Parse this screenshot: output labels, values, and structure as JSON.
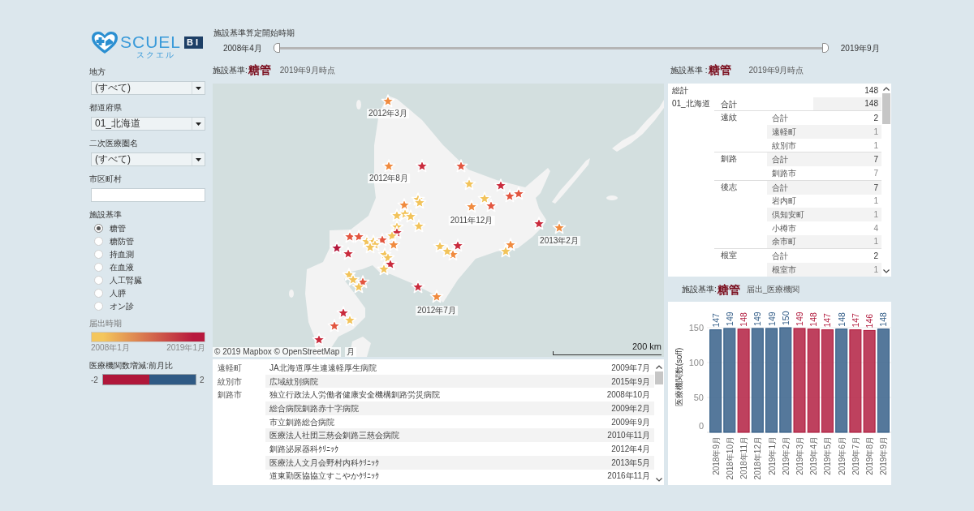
{
  "logo": {
    "name": "SCUEL",
    "kana": "スクエル",
    "badge": "BI"
  },
  "filters": [
    {
      "kind": "dropdown",
      "label": "地方",
      "value": "(すべて)"
    },
    {
      "kind": "dropdown",
      "label": "都道府県",
      "value": "01_北海道"
    },
    {
      "kind": "dropdown",
      "label": "二次医療圏名",
      "value": "(すべて)"
    },
    {
      "kind": "text",
      "label": "市区町村"
    }
  ],
  "facility_standard": {
    "label": "施設基準",
    "options": [
      {
        "label": "糖管",
        "selected": true
      },
      {
        "label": "糖防管",
        "selected": false
      },
      {
        "label": "持血測",
        "selected": false
      },
      {
        "label": "在血液",
        "selected": false
      },
      {
        "label": "人工腎臓",
        "selected": false
      },
      {
        "label": "人膵",
        "selected": false
      },
      {
        "label": "オン診",
        "selected": false
      }
    ]
  },
  "period_legend": {
    "title": "届出時期",
    "items": [
      {
        "label": "2008年1月",
        "color": "#f4c65c"
      },
      {
        "label": "2019年1月",
        "color": "#b8193e"
      }
    ]
  },
  "change_legend": {
    "title": "医療機関数増減:前月比",
    "items": [
      {
        "label": "-2",
        "color": "#b0173a"
      },
      {
        "label": "2",
        "color": "#2f5a85"
      }
    ]
  },
  "period_slider": {
    "title": "施設基準算定開始時期",
    "start_label": "2008年4月",
    "end_label": "2019年9月",
    "handles": [
      {
        "level": 0
      },
      {
        "level": 1
      }
    ]
  },
  "map_header": {
    "label": "施設基準:",
    "value": "糖管",
    "note": "2019年9月時点"
  },
  "map": {
    "markers": [
      {
        "color": "#f08a3e"
      },
      {
        "color": "#f08a3e"
      },
      {
        "color": "#c92a3c"
      },
      {
        "color": "#e2553f"
      },
      {
        "color": "#f2c35a"
      },
      {
        "color": "#c92a3c"
      },
      {
        "color": "#e2553f"
      },
      {
        "color": "#e2553f"
      },
      {
        "color": "#f2c35a"
      },
      {
        "color": "#e2553f"
      },
      {
        "color": "#f08a3e"
      },
      {
        "color": "#f2c35a"
      },
      {
        "color": "#f2c35a"
      },
      {
        "color": "#f08a3e"
      },
      {
        "color": "#f2c35a"
      },
      {
        "color": "#f2c35a"
      },
      {
        "color": "#f2c35a"
      },
      {
        "color": "#f2c35a"
      },
      {
        "color": "#f2c35a"
      },
      {
        "color": "#c92a3c"
      },
      {
        "color": "#f2c35a"
      },
      {
        "color": "#c92a3c"
      },
      {
        "color": "#f08a3e"
      },
      {
        "color": "#e2553f"
      },
      {
        "color": "#e2553f"
      },
      {
        "color": "#e2553f"
      },
      {
        "color": "#f08a3e"
      },
      {
        "color": "#f2c35a"
      },
      {
        "color": "#f2c35a"
      },
      {
        "color": "#f2c35a"
      },
      {
        "color": "#f2c35a"
      },
      {
        "color": "#b3163b"
      },
      {
        "color": "#c92a3c"
      },
      {
        "color": "#f2c35a"
      },
      {
        "color": "#f2c35a"
      },
      {
        "color": "#c92a3c"
      },
      {
        "color": "#f2c35a"
      },
      {
        "color": "#f2c35a"
      },
      {
        "color": "#c92a3c"
      },
      {
        "color": "#f08a3e"
      },
      {
        "color": "#f2c35a"
      },
      {
        "color": "#f08a3e"
      },
      {
        "color": "#f2c35a"
      },
      {
        "color": "#f2c35a"
      },
      {
        "color": "#f2c35a"
      },
      {
        "color": "#e2553f"
      },
      {
        "color": "#f2c35a"
      },
      {
        "color": "#c92a3c"
      },
      {
        "color": "#f08a3e"
      },
      {
        "color": "#c92a3c"
      },
      {
        "color": "#f2c35a"
      },
      {
        "color": "#e2553f"
      },
      {
        "color": "#c92a3c"
      }
    ],
    "date_labels": [
      "2012年3月",
      "2012年8月",
      "2011年12月",
      "2013年2月",
      "2012年7月",
      "月"
    ],
    "attribution": "© 2019 Mapbox © OpenStreetMap",
    "scale": "200 km"
  },
  "facility_list": {
    "groups": [
      {
        "city": "遠軽町",
        "rows": [
          {
            "name": "JA北海道厚生連遠軽厚生病院",
            "date": "2009年7月"
          }
        ]
      },
      {
        "city": "紋別市",
        "rows": [
          {
            "name": "広域紋別病院",
            "date": "2015年9月"
          }
        ]
      },
      {
        "city": "釧路市",
        "rows": [
          {
            "name": "独立行政法人労働者健康安全機構釧路労災病院",
            "date": "2008年10月"
          },
          {
            "name": "総合病院釧路赤十字病院",
            "date": "2009年2月"
          },
          {
            "name": "市立釧路総合病院",
            "date": "2009年9月"
          },
          {
            "name": "医療法人社団三慈会釧路三慈会病院",
            "date": "2010年11月"
          },
          {
            "name": "釧路泌尿器科ｸﾘﾆｯｸ",
            "date": "2012年4月"
          },
          {
            "name": "医療法人文月会野村内科ｸﾘﾆｯｸ",
            "date": "2013年5月"
          },
          {
            "name": "道東勤医協協立すこやかｸﾘﾆｯｸ",
            "date": "2016年11月"
          }
        ]
      }
    ]
  },
  "table_header": {
    "label": "施設基準 :",
    "value": "糖管",
    "note": "2019年9月時点"
  },
  "count_table": {
    "grand_total": {
      "label": "総計",
      "value": "148"
    },
    "prefectures": [
      {
        "name": "01_北海道",
        "total": {
          "label": "合計",
          "value": "148"
        },
        "regions": [
          {
            "name": "遠紋",
            "total": {
              "label": "合計",
              "value": "2"
            },
            "rows": [
              {
                "label": "遠軽町",
                "value": "1"
              },
              {
                "label": "紋別市",
                "value": "1"
              }
            ]
          },
          {
            "name": "釧路",
            "total": {
              "label": "合計",
              "value": "7"
            },
            "rows": [
              {
                "label": "釧路市",
                "value": "7"
              }
            ]
          },
          {
            "name": "後志",
            "total": {
              "label": "合計",
              "value": "7"
            },
            "rows": [
              {
                "label": "岩内町",
                "value": "1"
              },
              {
                "label": "倶知安町",
                "value": "1"
              },
              {
                "label": "小樽市",
                "value": "4"
              },
              {
                "label": "余市町",
                "value": "1"
              }
            ]
          },
          {
            "name": "根室",
            "total": {
              "label": "合計",
              "value": "2"
            },
            "rows": [
              {
                "label": "根室市",
                "value": "1"
              }
            ]
          }
        ]
      }
    ]
  },
  "chart_header": {
    "label": "施設基準:",
    "value": "糖管",
    "note": "届出_医療機関"
  },
  "chart": {
    "chart_data": {
      "type": "bar",
      "ylabel": "医療機関数(soff)",
      "categories": [
        "2018年9月",
        "2018年10月",
        "2018年11月",
        "2018年12月",
        "2019年1月",
        "2019年2月",
        "2019年3月",
        "2019年4月",
        "2019年5月",
        "2019年6月",
        "2019年7月",
        "2019年8月",
        "2019年9月"
      ],
      "series": [
        {
          "values": [
            147,
            149,
            148,
            149,
            149,
            150,
            149,
            148,
            147,
            148,
            147,
            146,
            148
          ]
        }
      ],
      "ylim": [
        0,
        150
      ],
      "yticks": [
        0,
        50,
        100,
        150
      ],
      "grid": true,
      "data_labels": true
    }
  }
}
